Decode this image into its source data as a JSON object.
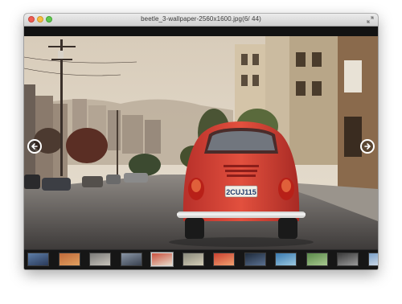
{
  "window": {
    "title": "beetle_3-wallpaper-2560x1600.jpg(6/ 44)"
  },
  "icons": {
    "close": "close-icon",
    "minimize": "minimize-icon",
    "maximize": "maximize-icon",
    "fullscreen": "fullscreen-arrows-icon",
    "previous": "arrow-left-icon",
    "next": "arrow-right-icon"
  },
  "colors": {
    "car_body": "#d84434",
    "sky": "#dcd2c2",
    "road": "#5d5957",
    "filmstrip_bg": "#161616"
  },
  "photo": {
    "license_plate": "2CUJ115"
  },
  "filmstrip": {
    "current_index": 6,
    "total": 44,
    "thumbnails": [
      {
        "palette": [
          "#5d7ea8",
          "#2a3a5a"
        ]
      },
      {
        "palette": [
          "#c06a3a",
          "#e0a060"
        ]
      },
      {
        "palette": [
          "#7a7a78",
          "#c8c4bc"
        ]
      },
      {
        "palette": [
          "#8a96a6",
          "#3a4250"
        ]
      },
      {
        "palette": [
          "#c9503e",
          "#e8dccb"
        ]
      },
      {
        "palette": [
          "#8a8a7c",
          "#d4ceb8"
        ]
      },
      {
        "palette": [
          "#c84030",
          "#f0a070"
        ]
      },
      {
        "palette": [
          "#1e2a3a",
          "#5a7090"
        ]
      },
      {
        "palette": [
          "#3a7ab0",
          "#9ac8e0"
        ]
      },
      {
        "palette": [
          "#5a8a4a",
          "#a8c890"
        ]
      },
      {
        "palette": [
          "#3a3a3a",
          "#9a9a9a"
        ]
      },
      {
        "palette": [
          "#7aa0c8",
          "#e0e8f0"
        ]
      }
    ]
  }
}
